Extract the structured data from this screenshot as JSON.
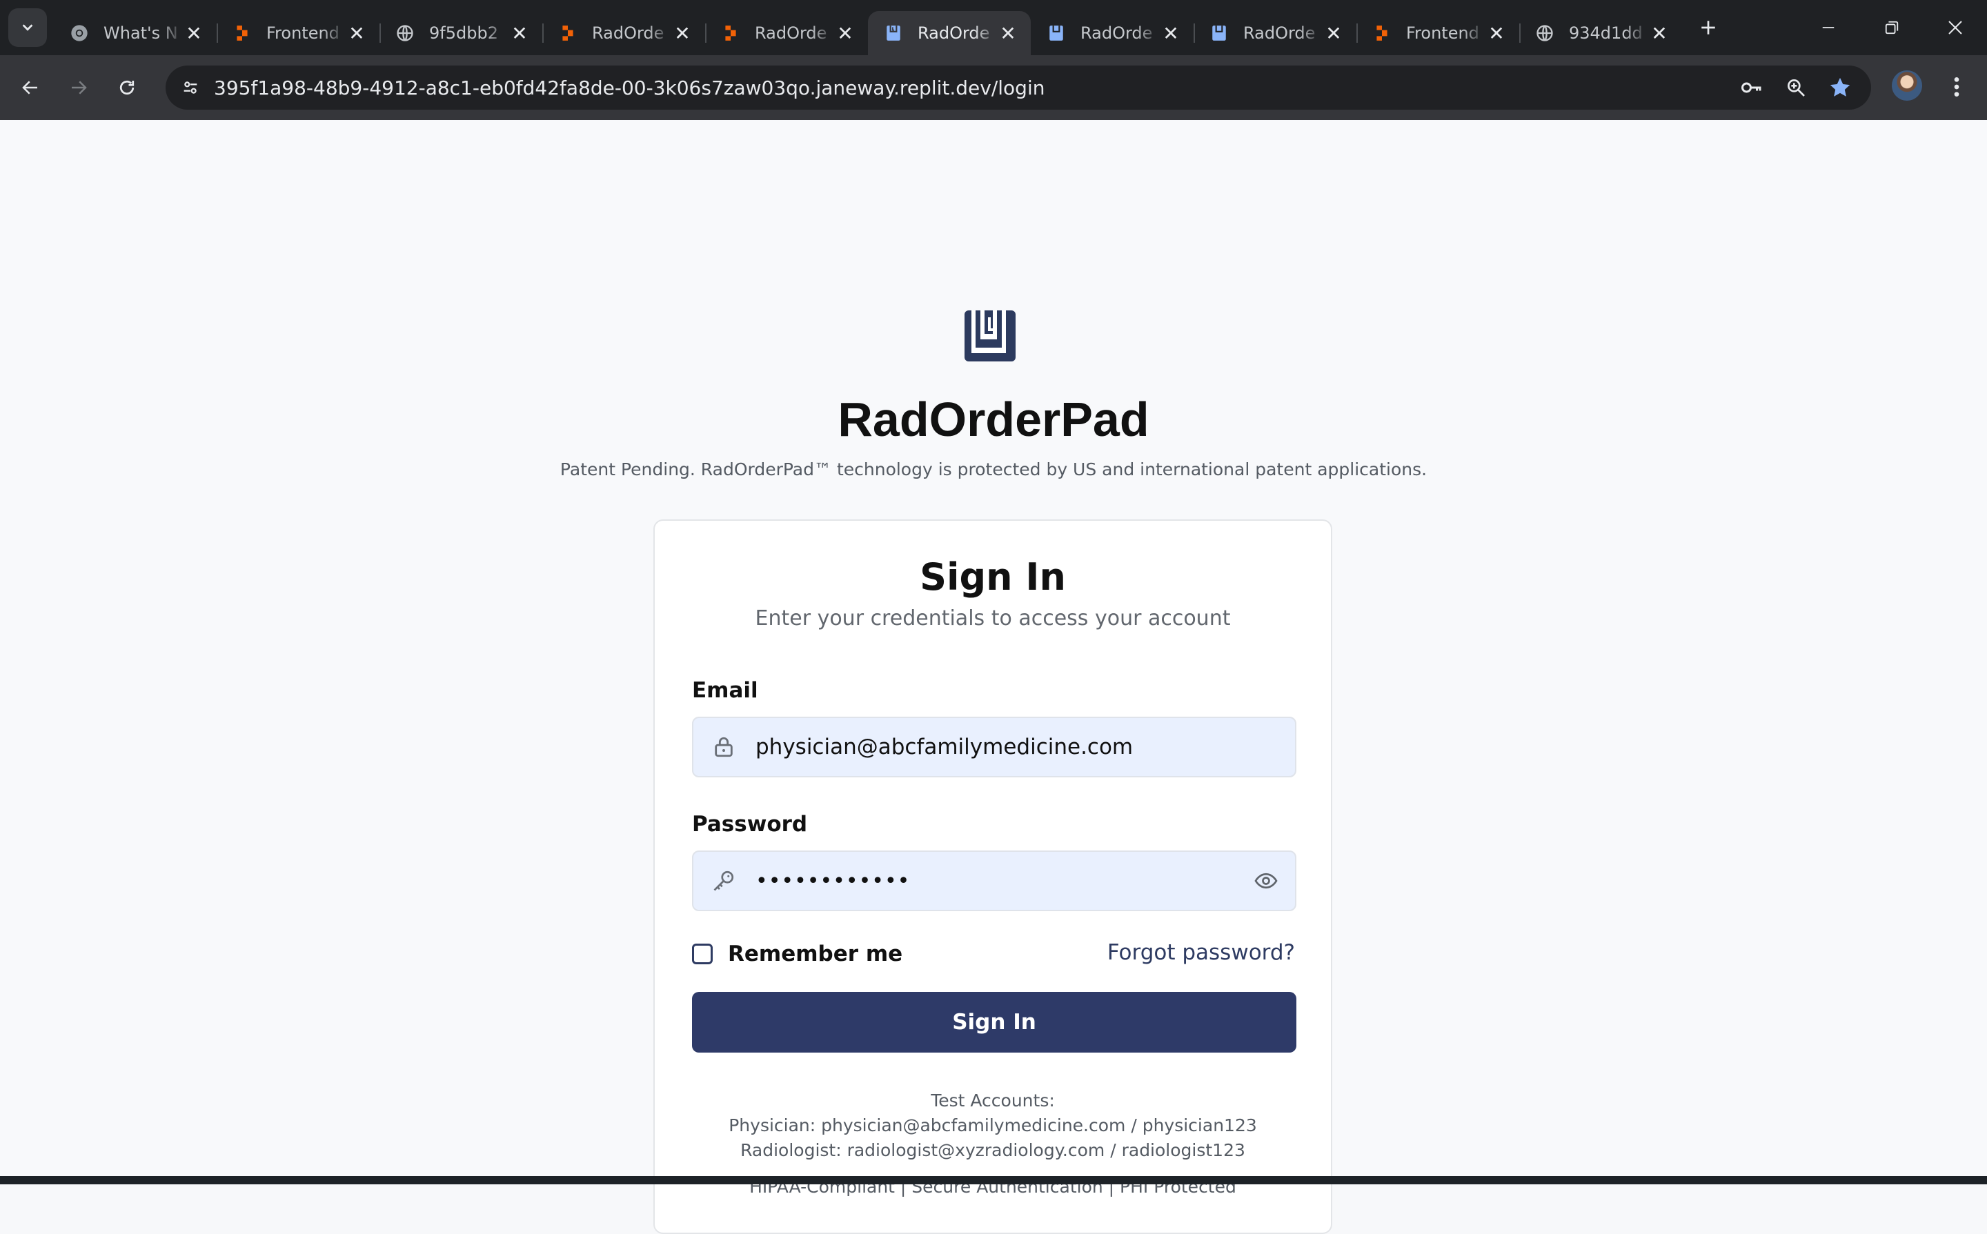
{
  "browser": {
    "tabs": [
      {
        "title": "What's N",
        "favicon": "chrome-icon",
        "active": false
      },
      {
        "title": "Frontend",
        "favicon": "replit-icon",
        "active": false
      },
      {
        "title": "9f5dbb2",
        "favicon": "globe-icon",
        "active": false
      },
      {
        "title": "RadOrde",
        "favicon": "replit-icon",
        "active": false
      },
      {
        "title": "RadOrde",
        "favicon": "replit-icon",
        "active": false
      },
      {
        "title": "RadOrde",
        "favicon": "radorderpad-icon",
        "active": true
      },
      {
        "title": "RadOrde",
        "favicon": "radorderpad-icon",
        "active": false
      },
      {
        "title": "RadOrde",
        "favicon": "radorderpad-icon",
        "active": false
      },
      {
        "title": "Frontend",
        "favicon": "replit-icon",
        "active": false
      },
      {
        "title": "934d1dd",
        "favicon": "globe-icon",
        "active": false
      }
    ],
    "url": "395f1a98-48b9-4912-a8c1-eb0fd42fa8de-00-3k06s7zaw03qo.janeway.replit.dev/login"
  },
  "app": {
    "name": "RadOrderPad",
    "patent_notice": "Patent Pending. RadOrderPad™ technology is protected by US and international patent applications."
  },
  "signin": {
    "title": "Sign In",
    "subtitle": "Enter your credentials to access your account",
    "email_label": "Email",
    "email_value": "physician@abcfamilymedicine.com",
    "password_label": "Password",
    "password_value": "••••••••••••",
    "remember_label": "Remember me",
    "remember_checked": false,
    "forgot_label": "Forgot password?",
    "button_label": "Sign In",
    "test_accounts_heading": "Test Accounts:",
    "test_physician": "Physician: physician@abcfamilymedicine.com / physician123",
    "test_radiologist": "Radiologist: radiologist@xyzradiology.com / radiologist123",
    "footer": "HIPAA-Compliant | Secure Authentication | PHI Protected"
  },
  "colors": {
    "brand_navy": "#2e3a68",
    "field_bg": "#e9f0fe",
    "chrome_dark": "#1f2124",
    "replit_orange": "#f26207"
  }
}
